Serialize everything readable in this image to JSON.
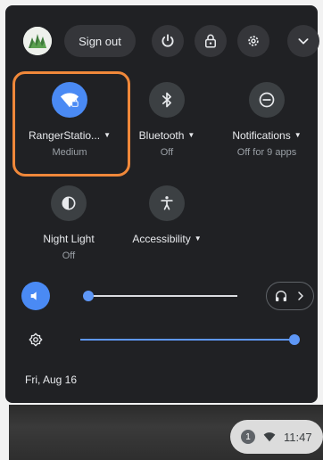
{
  "header": {
    "avatar_icon": "profile-avatar",
    "sign_out_label": "Sign out",
    "power_icon": "power-icon",
    "lock_icon": "lock-icon",
    "settings_icon": "gear-icon",
    "collapse_icon": "chevron-down-icon"
  },
  "tiles": {
    "network": {
      "label": "RangerStatio...",
      "sublabel": "Medium",
      "icon": "wifi-locked-icon",
      "active": true
    },
    "bluetooth": {
      "label": "Bluetooth",
      "sublabel": "Off",
      "icon": "bluetooth-icon"
    },
    "notifications": {
      "label": "Notifications",
      "sublabel": "Off for 9 apps",
      "icon": "do-not-disturb-icon"
    },
    "night_light": {
      "label": "Night Light",
      "sublabel": "Off",
      "icon": "night-light-icon"
    },
    "accessibility": {
      "label": "Accessibility",
      "icon": "accessibility-icon"
    }
  },
  "volume": {
    "icon": "volume-icon",
    "level": 0.02,
    "output_icon": "headphones-icon"
  },
  "brightness": {
    "icon": "brightness-icon",
    "level": 1.0
  },
  "date_label": "Fri, Aug 16",
  "tray": {
    "notification_count": "1",
    "time": "11:47"
  },
  "colors": {
    "accent": "#4a8af4",
    "panel_bg": "#202124",
    "highlight": "#f0883a"
  }
}
